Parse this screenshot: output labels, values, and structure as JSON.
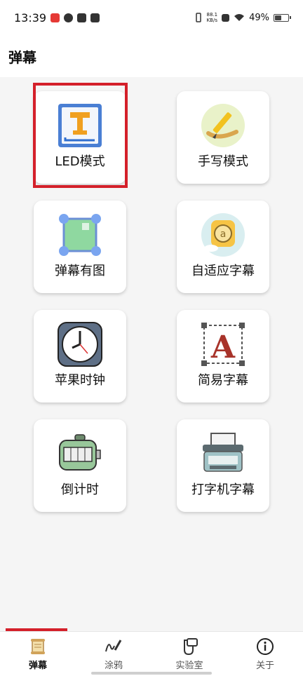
{
  "status_bar": {
    "time": "13:39",
    "net_speed_value": "88.1",
    "net_speed_unit": "KB/s",
    "battery": "49%",
    "battery_level": 0.49
  },
  "header": {
    "title": "弹幕"
  },
  "grid": {
    "items": [
      {
        "label": "LED模式",
        "icon": "led-text-icon",
        "highlighted": true
      },
      {
        "label": "手写模式",
        "icon": "handwriting-icon"
      },
      {
        "label": "弹幕有图",
        "icon": "image-frame-icon"
      },
      {
        "label": "自适应字幕",
        "icon": "adaptive-caption-icon"
      },
      {
        "label": "苹果时钟",
        "icon": "clock-icon"
      },
      {
        "label": "简易字幕",
        "icon": "simple-caption-icon"
      },
      {
        "label": "倒计时",
        "icon": "countdown-icon"
      },
      {
        "label": "打字机字幕",
        "icon": "typewriter-icon"
      }
    ]
  },
  "bottom_nav": {
    "items": [
      {
        "label": "弹幕",
        "icon": "scroll-icon",
        "active": true
      },
      {
        "label": "涂鸦",
        "icon": "signature-pen-icon"
      },
      {
        "label": "实验室",
        "icon": "lab-icon"
      },
      {
        "label": "关于",
        "icon": "info-icon"
      }
    ]
  },
  "colors": {
    "highlight": "#d4202a",
    "background": "#f5f5f5"
  }
}
